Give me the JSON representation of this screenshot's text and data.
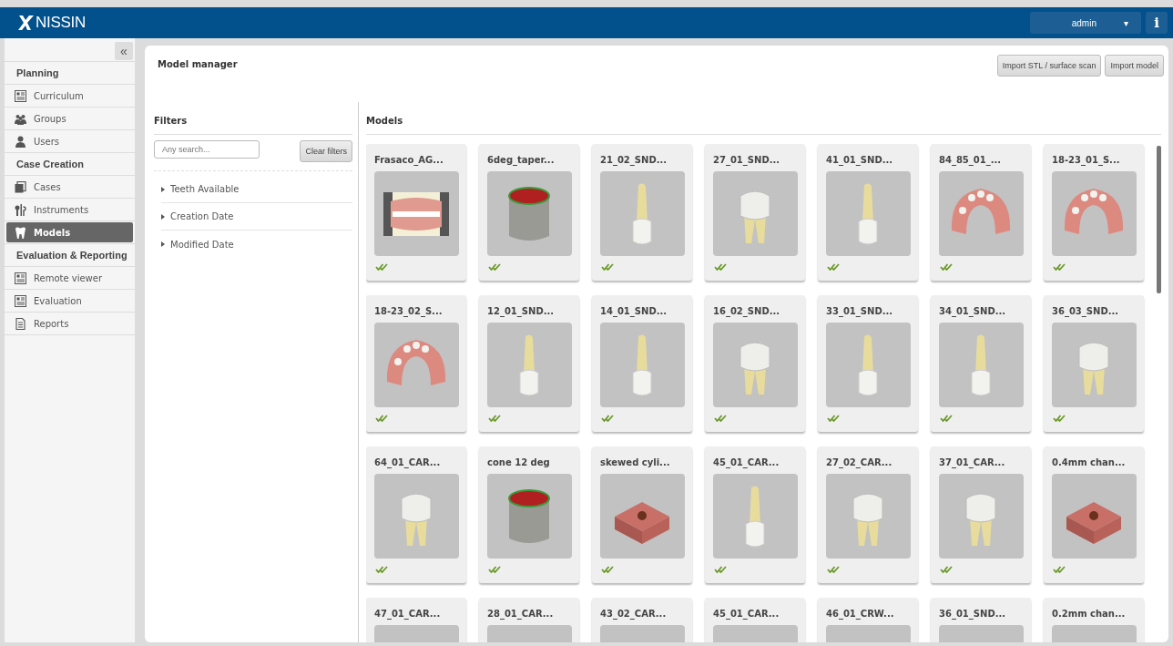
{
  "header": {
    "brand": "NISSIN",
    "user_menu": {
      "label": "admin",
      "caret": "▾"
    },
    "info_button": "i"
  },
  "sidebar": {
    "collapse_button": "«",
    "items": [
      {
        "kind": "header",
        "label": "Planning"
      },
      {
        "kind": "item",
        "label": "Curriculum",
        "selected": false
      },
      {
        "kind": "item",
        "label": "Groups",
        "selected": false
      },
      {
        "kind": "item",
        "label": "Users",
        "selected": false
      },
      {
        "kind": "header",
        "label": "Case Creation"
      },
      {
        "kind": "item",
        "label": "Cases",
        "selected": false
      },
      {
        "kind": "item",
        "label": "Instruments",
        "selected": false
      },
      {
        "kind": "item",
        "label": "Models",
        "selected": true
      },
      {
        "kind": "header",
        "label": "Evaluation & Reporting"
      },
      {
        "kind": "item",
        "label": "Remote viewer",
        "selected": false
      },
      {
        "kind": "item",
        "label": "Evaluation",
        "selected": false
      },
      {
        "kind": "item",
        "label": "Reports",
        "selected": false
      }
    ]
  },
  "page": {
    "title": "Model manager",
    "buttons": [
      "Import STL / surface scan",
      "Import model"
    ]
  },
  "filters": {
    "title": "Filters",
    "search": {
      "placeholder": "Any search..."
    },
    "clear_button": "Clear filters",
    "groups": [
      {
        "label": "Teeth Available",
        "expanded": false
      },
      {
        "label": "Creation Date",
        "expanded": false
      },
      {
        "label": "Modified Date",
        "expanded": false
      }
    ]
  },
  "models": {
    "title": "Models",
    "items": [
      {
        "name": "Frasaco_AG...",
        "kind": "jaws",
        "validated": true
      },
      {
        "name": "6deg_taper...",
        "kind": "cylinder",
        "validated": true
      },
      {
        "name": "21_02_SND...",
        "kind": "tooth",
        "validated": true
      },
      {
        "name": "27_01_SND...",
        "kind": "molar",
        "validated": true
      },
      {
        "name": "41_01_SND...",
        "kind": "tooth",
        "validated": true
      },
      {
        "name": "84_85_01_...",
        "kind": "jaw",
        "validated": true
      },
      {
        "name": "18-23_01_S...",
        "kind": "jaw",
        "validated": true
      },
      {
        "name": "18-23_02_S...",
        "kind": "jaw",
        "validated": true
      },
      {
        "name": "12_01_SND...",
        "kind": "tooth",
        "validated": true
      },
      {
        "name": "14_01_SND...",
        "kind": "tooth",
        "validated": true
      },
      {
        "name": "16_02_SND...",
        "kind": "molar",
        "validated": true
      },
      {
        "name": "33_01_SND...",
        "kind": "tooth",
        "validated": true
      },
      {
        "name": "34_01_SND...",
        "kind": "tooth",
        "validated": true
      },
      {
        "name": "36_03_SND...",
        "kind": "molar",
        "validated": true
      },
      {
        "name": "64_01_CAR...",
        "kind": "molar",
        "validated": true
      },
      {
        "name": "cone 12 deg",
        "kind": "cylinder",
        "validated": true
      },
      {
        "name": "skewed cyli...",
        "kind": "block",
        "validated": true
      },
      {
        "name": "45_01_CAR...",
        "kind": "tooth",
        "validated": true
      },
      {
        "name": "27_02_CAR...",
        "kind": "molar",
        "validated": true
      },
      {
        "name": "37_01_CAR...",
        "kind": "molar",
        "validated": true
      },
      {
        "name": "0.4mm chan...",
        "kind": "block",
        "validated": true
      },
      {
        "name": "47_01_CAR..."
      },
      {
        "name": "28_01_CAR..."
      },
      {
        "name": "43_02_CAR..."
      },
      {
        "name": "45_01_CAR..."
      },
      {
        "name": "46_01_CRW..."
      },
      {
        "name": "36_01_SND..."
      },
      {
        "name": "0.2mm chan..."
      }
    ]
  }
}
